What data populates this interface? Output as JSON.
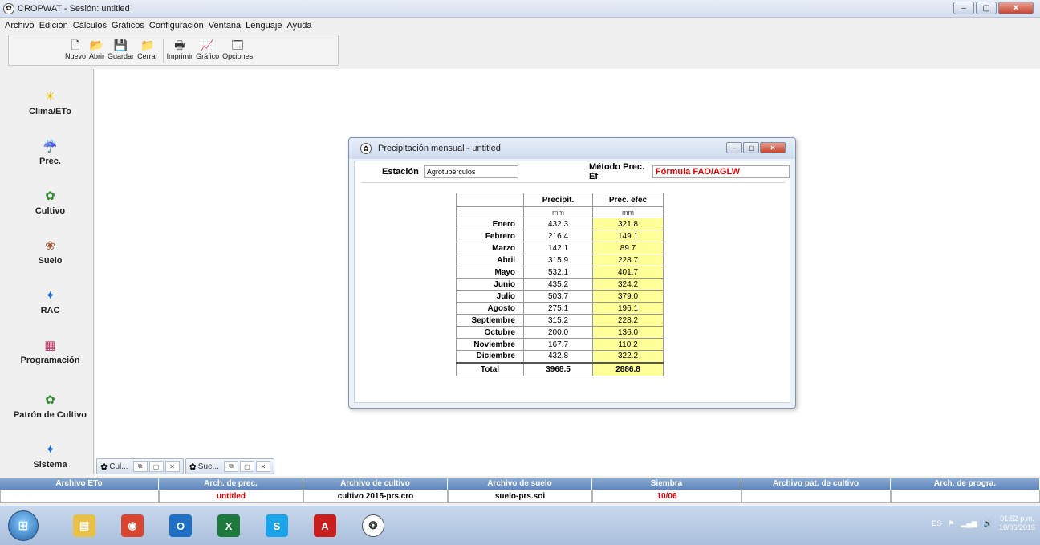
{
  "app": {
    "title": "CROPWAT - Sesión: untitled"
  },
  "menu": [
    "Archivo",
    "Edición",
    "Cálculos",
    "Gráficos",
    "Configuración",
    "Ventana",
    "Lenguaje",
    "Ayuda"
  ],
  "toolbar": [
    {
      "label": "Nuevo",
      "icon": "new-file-icon",
      "glyph": "🗋"
    },
    {
      "label": "Abrir",
      "icon": "open-folder-icon",
      "glyph": "📂"
    },
    {
      "label": "Guardar",
      "icon": "save-icon",
      "glyph": "💾"
    },
    {
      "label": "Cerrar",
      "icon": "close-file-icon",
      "glyph": "📁"
    },
    {
      "label": "Imprimir",
      "icon": "printer-icon",
      "glyph": "🖶"
    },
    {
      "label": "Gráfico",
      "icon": "chart-icon",
      "glyph": "📈"
    },
    {
      "label": "Opciones",
      "icon": "options-icon",
      "glyph": "🗔"
    }
  ],
  "sidebar": [
    {
      "label": "Clima/ETo",
      "icon": "sun-icon",
      "glyph": "☀",
      "color": "#e6c000"
    },
    {
      "label": "Prec.",
      "icon": "rain-cloud-icon",
      "glyph": "☔",
      "color": "#1c6fd0"
    },
    {
      "label": "Cultivo",
      "icon": "crop-icon",
      "glyph": "✿",
      "color": "#2f8f2f"
    },
    {
      "label": "Suelo",
      "icon": "soil-icon",
      "glyph": "❀",
      "color": "#a0522d"
    },
    {
      "label": "RAC",
      "icon": "rac-icon",
      "glyph": "✦",
      "color": "#1c6fd0"
    },
    {
      "label": "Programación",
      "icon": "schedule-icon",
      "glyph": "▦",
      "color": "#c03060"
    },
    {
      "label": "Patrón de Cultivo",
      "icon": "crop-pattern-icon",
      "glyph": "✿",
      "color": "#2f8f2f"
    },
    {
      "label": "Sistema",
      "icon": "system-icon",
      "glyph": "✦",
      "color": "#1c6fd0"
    }
  ],
  "window": {
    "title": "Precipitación mensual - untitled",
    "station_label": "Estación",
    "station_value": "Agrotubérculos",
    "method_label": "Método Prec. Ef",
    "method_value": "Fórmula FAO/AGLW"
  },
  "table": {
    "col1": "Precipit.",
    "col2": "Prec. efec",
    "unit1": "mm",
    "unit2": "mm",
    "rows": [
      {
        "month": "Enero",
        "precip": "432.3",
        "eff": "321.8"
      },
      {
        "month": "Febrero",
        "precip": "216.4",
        "eff": "149.1"
      },
      {
        "month": "Marzo",
        "precip": "142.1",
        "eff": "89.7"
      },
      {
        "month": "Abril",
        "precip": "315.9",
        "eff": "228.7"
      },
      {
        "month": "Mayo",
        "precip": "532.1",
        "eff": "401.7"
      },
      {
        "month": "Junio",
        "precip": "435.2",
        "eff": "324.2"
      },
      {
        "month": "Julio",
        "precip": "503.7",
        "eff": "379.0"
      },
      {
        "month": "Agosto",
        "precip": "275.1",
        "eff": "196.1"
      },
      {
        "month": "Septiembre",
        "precip": "315.2",
        "eff": "228.2"
      },
      {
        "month": "Octubre",
        "precip": "200.0",
        "eff": "136.0"
      },
      {
        "month": "Noviembre",
        "precip": "167.7",
        "eff": "110.2"
      },
      {
        "month": "Diciembre",
        "precip": "432.8",
        "eff": "322.2"
      }
    ],
    "total_label": "Total",
    "total_precip": "3968.5",
    "total_eff": "2886.8"
  },
  "minitabs": [
    {
      "label": "Cul...",
      "icon": "app-icon"
    },
    {
      "label": "Sue...",
      "icon": "app-icon"
    }
  ],
  "status": [
    {
      "header": "Archivo ETo",
      "value": "",
      "red": false
    },
    {
      "header": "Arch. de prec.",
      "value": "untitled",
      "red": true
    },
    {
      "header": "Archivo de cultivo",
      "value": "cultivo 2015-prs.cro",
      "red": false
    },
    {
      "header": "Archivo de suelo",
      "value": "suelo-prs.soi",
      "red": false
    },
    {
      "header": "Siembra",
      "value": "10/06",
      "red": true
    },
    {
      "header": "Archivo pat. de cultivo",
      "value": "",
      "red": false
    },
    {
      "header": "Arch. de progra.",
      "value": "",
      "red": false
    }
  ],
  "taskbar": {
    "apps": [
      {
        "name": "explorer",
        "icon": "folder-icon",
        "glyph": "▤",
        "color": "#e8c04a"
      },
      {
        "name": "chrome",
        "icon": "chrome-icon",
        "glyph": "◉",
        "color": "#d9452f"
      },
      {
        "name": "outlook",
        "icon": "outlook-icon",
        "glyph": "O",
        "color": "#1f6fc4"
      },
      {
        "name": "excel",
        "icon": "excel-icon",
        "glyph": "X",
        "color": "#1e7a3c"
      },
      {
        "name": "skype",
        "icon": "skype-icon",
        "glyph": "S",
        "color": "#1aa3e8"
      },
      {
        "name": "acrobat",
        "icon": "acrobat-icon",
        "glyph": "A",
        "color": "#c81e1e"
      },
      {
        "name": "cropwat",
        "icon": "cropwat-icon",
        "glyph": "❂",
        "color": "#ffffff"
      }
    ],
    "lang": "ES",
    "time": "01:52 p.m.",
    "date": "10/06/2016"
  }
}
